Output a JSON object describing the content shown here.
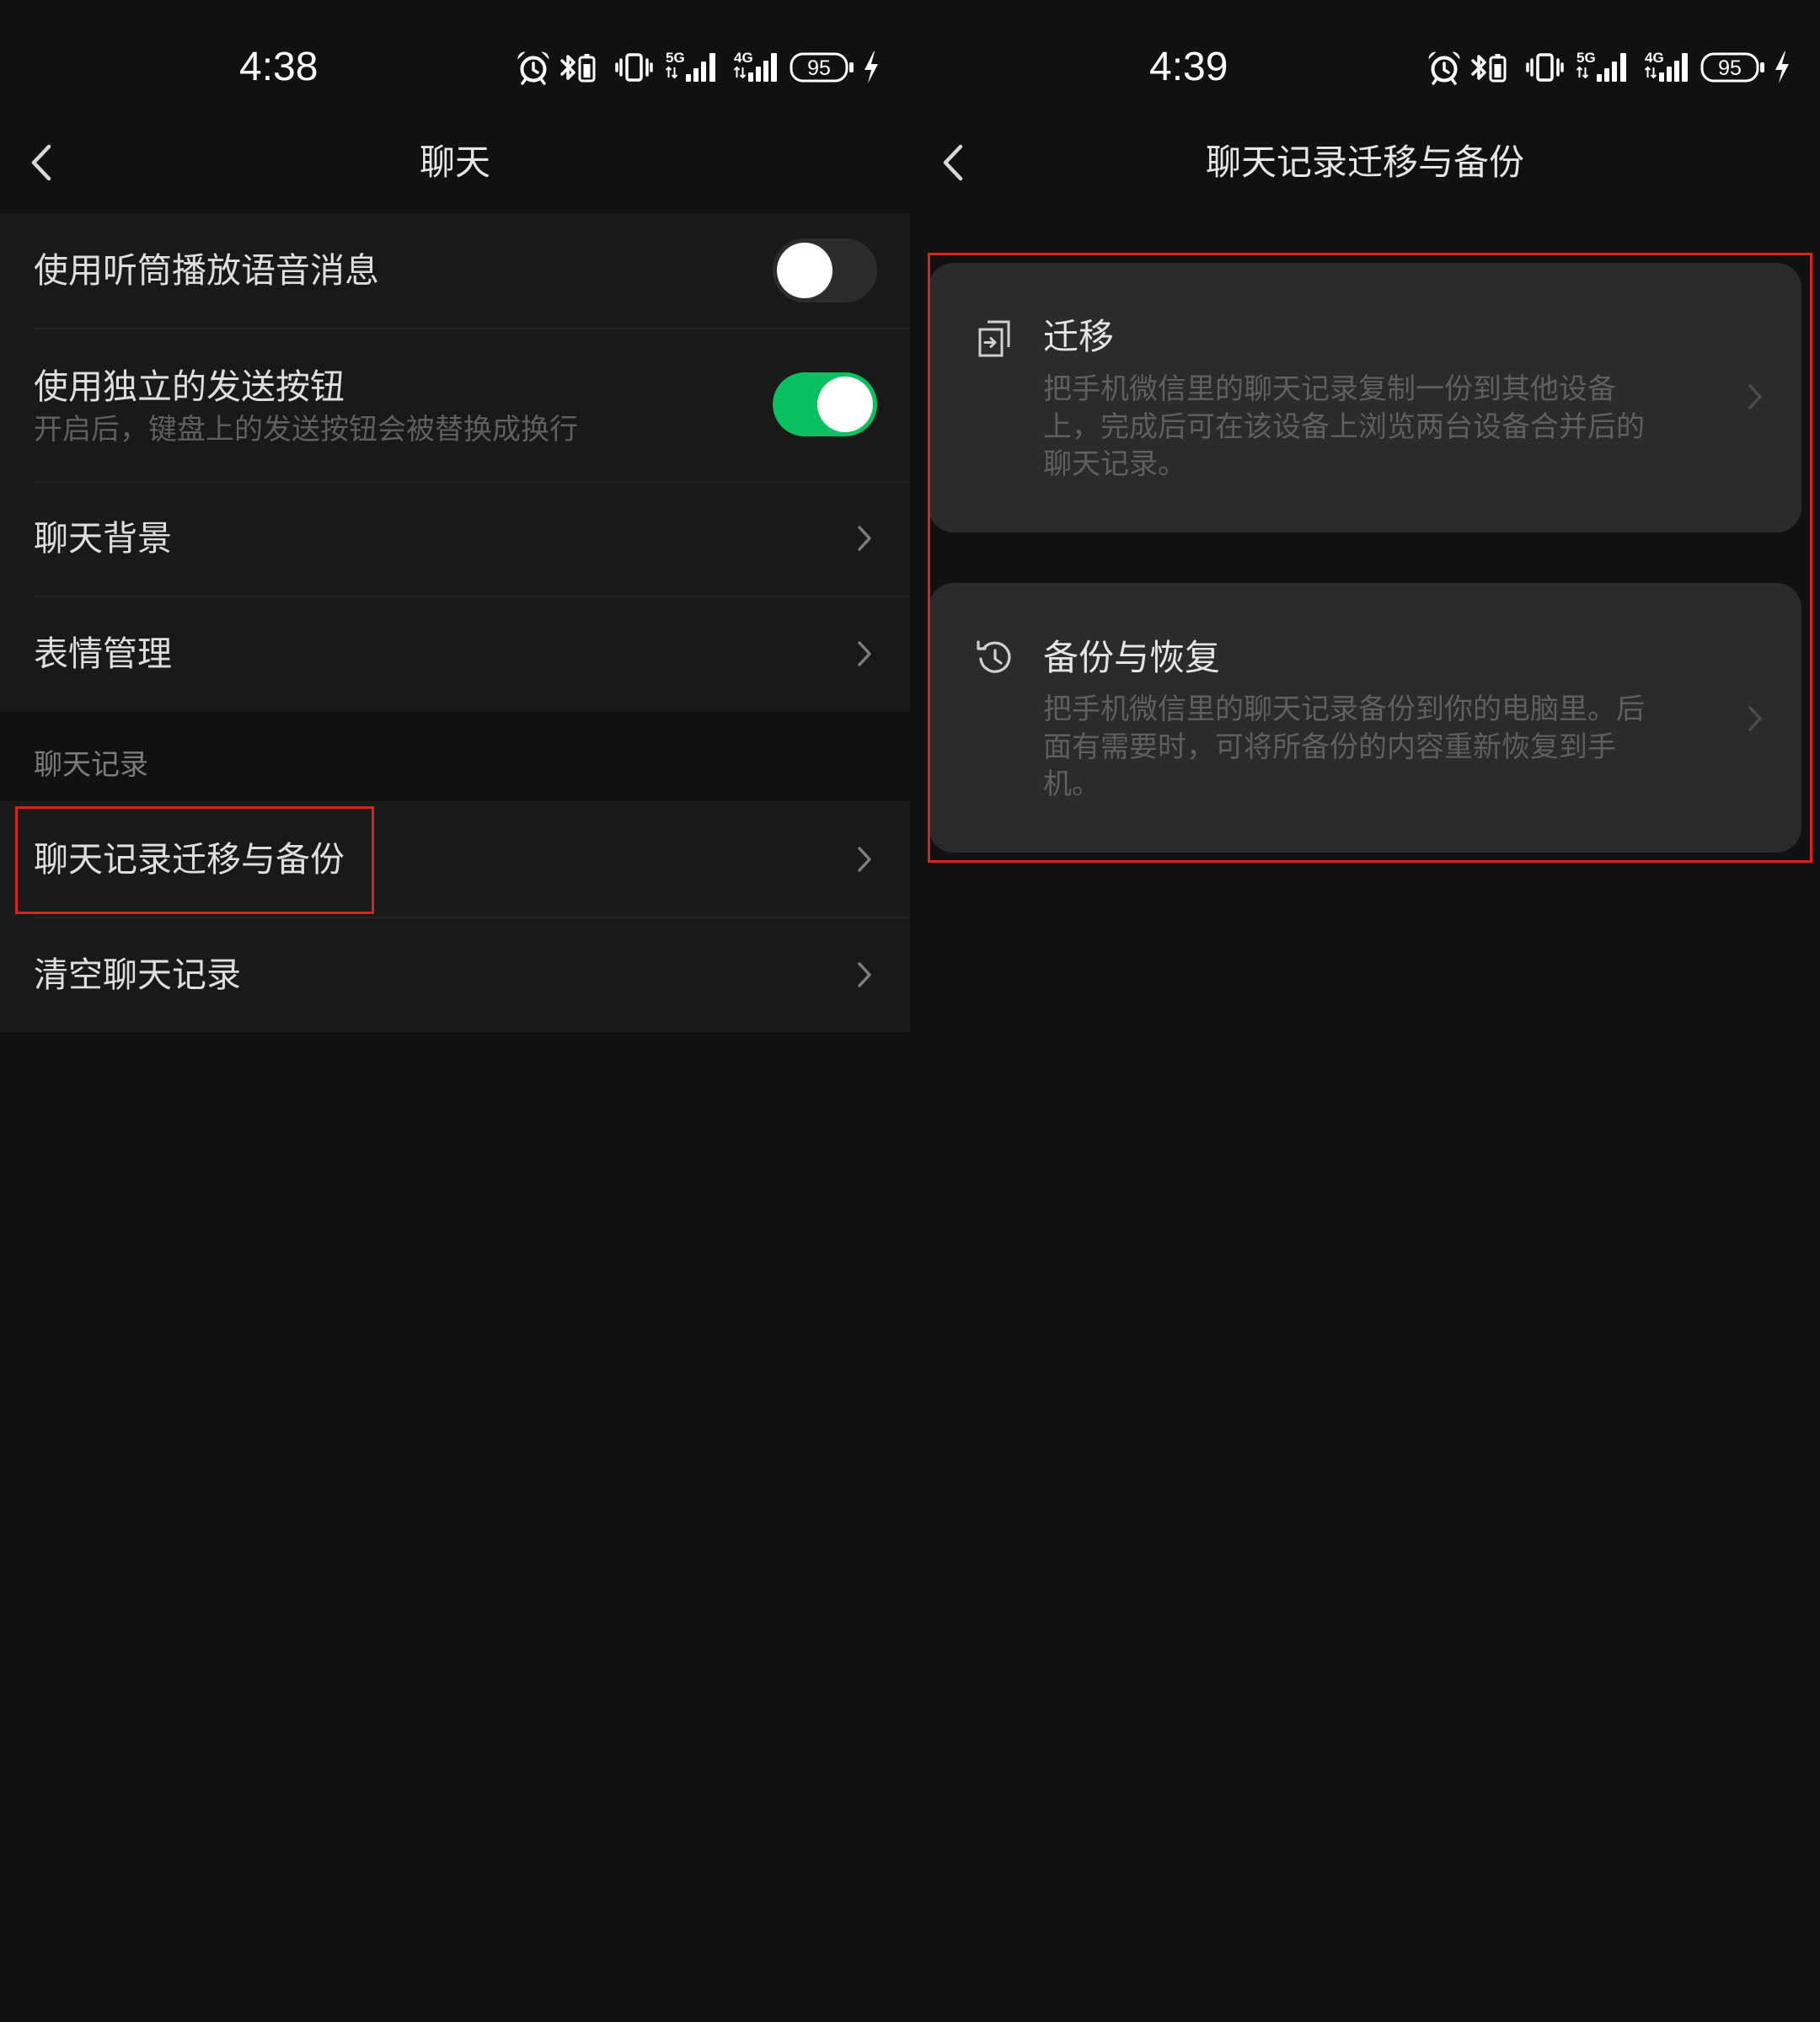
{
  "colors": {
    "background": "#111111",
    "row_background": "#191919",
    "divider": "#242424",
    "card_background": "#2b2b2b",
    "text_primary": "#dedede",
    "text_secondary": "#5f5f5f",
    "section_label": "#7b7b7b",
    "accent_green": "#07c160",
    "toggle_off": "#2c2c2c",
    "highlight_red": "#d9231f"
  },
  "icons": {
    "status_bar": [
      "alarm-icon",
      "bluetooth-battery-icon",
      "vibrate-icon",
      "signal-5g-icon",
      "signal-4g-icon",
      "battery-icon",
      "charging-icon"
    ],
    "nav_back": "chevron-left-icon",
    "row_arrow": "chevron-right-icon",
    "migrate": "migrate-icon",
    "backup_restore": "history-icon"
  },
  "left_screen": {
    "status_bar": {
      "time": "4:38",
      "network_1": "5G",
      "network_2": "4G",
      "battery": "95"
    },
    "nav": {
      "title": "聊天"
    },
    "group1": [
      {
        "label": "使用听筒播放语音消息",
        "toggle_on": false
      },
      {
        "label": "使用独立的发送按钮",
        "subtitle": "开启后，键盘上的发送按钮会被替换成换行",
        "toggle_on": true
      },
      {
        "label": "聊天背景"
      },
      {
        "label": "表情管理"
      }
    ],
    "section_label": "聊天记录",
    "group2": [
      {
        "label": "聊天记录迁移与备份"
      },
      {
        "label": "清空聊天记录"
      }
    ]
  },
  "right_screen": {
    "status_bar": {
      "time": "4:39",
      "network_1": "5G",
      "network_2": "4G",
      "battery": "95"
    },
    "nav": {
      "title": "聊天记录迁移与备份"
    },
    "cards": [
      {
        "title": "迁移",
        "description_lines": [
          "把手机微信里的聊天记录复制一份到其他设备",
          "上，完成后可在该设备上浏览两台设备合并后的",
          "聊天记录。"
        ]
      },
      {
        "title": "备份与恢复",
        "description_lines": [
          "把手机微信里的聊天记录备份到你的电脑里。后",
          "面有需要时，可将所备份的内容重新恢复到手",
          "机。"
        ]
      }
    ]
  }
}
